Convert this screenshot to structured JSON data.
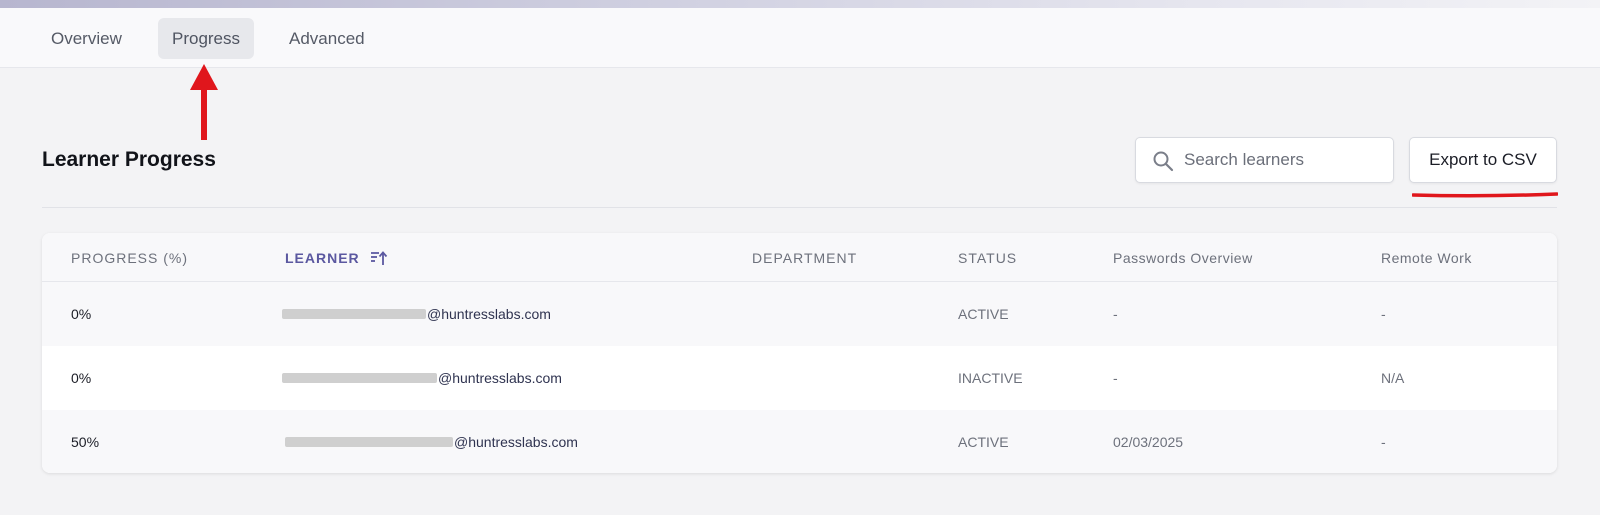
{
  "tabs": [
    {
      "label": "Overview",
      "active": false
    },
    {
      "label": "Progress",
      "active": true
    },
    {
      "label": "Advanced",
      "active": false
    }
  ],
  "page": {
    "title": "Learner Progress"
  },
  "search": {
    "placeholder": "Search learners",
    "value": ""
  },
  "export_button": {
    "label": "Export to CSV"
  },
  "table": {
    "columns": [
      {
        "label": "PROGRESS (%)"
      },
      {
        "label": "LEARNER",
        "sorted": "ascending"
      },
      {
        "label": "DEPARTMENT"
      },
      {
        "label": "STATUS"
      },
      {
        "label": "Passwords Overview"
      },
      {
        "label": "Remote Work"
      }
    ],
    "rows": [
      {
        "progress": "0%",
        "learner_domain": "@huntresslabs.com",
        "department": "",
        "status": "ACTIVE",
        "passwords_overview": "-",
        "remote_work": "-"
      },
      {
        "progress": "0%",
        "learner_domain": "@huntresslabs.com",
        "department": "",
        "status": "INACTIVE",
        "passwords_overview": "-",
        "remote_work": "N/A"
      },
      {
        "progress": "50%",
        "learner_domain": "@huntresslabs.com",
        "department": "",
        "status": "ACTIVE",
        "passwords_overview": "02/03/2025",
        "remote_work": "-"
      }
    ]
  },
  "icons": {
    "search": "search-icon",
    "sort": "sort-ascending-icon",
    "annotation_arrow": "red-arrow-up-icon"
  },
  "colors": {
    "accent": "#5b58a0",
    "annotation": "#e0161c"
  }
}
